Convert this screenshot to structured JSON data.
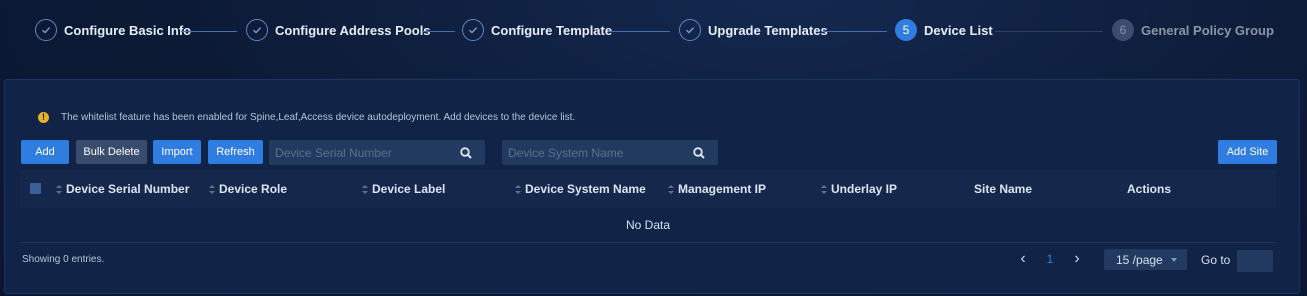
{
  "stepper": {
    "steps": [
      {
        "label": "Configure Basic Info",
        "state": "done"
      },
      {
        "label": "Configure Address Pools",
        "state": "done"
      },
      {
        "label": "Configure Template",
        "state": "done"
      },
      {
        "label": "Upgrade Templates",
        "state": "done"
      },
      {
        "label": "Device List",
        "state": "active",
        "number": "5"
      },
      {
        "label": "General Policy Group",
        "state": "pending",
        "number": "6"
      }
    ]
  },
  "notice": {
    "icon": "warning-icon",
    "text": "The whitelist feature has been enabled for Spine,Leaf,Access device autodeployment. Add devices to the device list."
  },
  "toolbar": {
    "add_label": "Add",
    "bulk_delete_label": "Bulk Delete",
    "import_label": "Import",
    "refresh_label": "Refresh",
    "add_site_label": "Add Site",
    "serial_search_placeholder": "Device Serial Number",
    "name_search_placeholder": "Device System Name"
  },
  "table": {
    "columns": [
      {
        "label": "Device Serial Number",
        "sortable": true
      },
      {
        "label": "Device Role",
        "sortable": true
      },
      {
        "label": "Device Label",
        "sortable": true
      },
      {
        "label": "Device System Name",
        "sortable": true
      },
      {
        "label": "Management IP",
        "sortable": true
      },
      {
        "label": "Underlay IP",
        "sortable": true
      },
      {
        "label": "Site Name",
        "sortable": false
      },
      {
        "label": "Actions",
        "sortable": false
      }
    ],
    "empty_text": "No Data"
  },
  "footer": {
    "showing": "Showing 0 entries.",
    "current_page": "1",
    "page_size": "15 /page",
    "goto_label": "Go to"
  },
  "colors": {
    "accent": "#2f7de1",
    "background": "#0c1a35",
    "panel": "#112347",
    "warning": "#e6b325"
  }
}
